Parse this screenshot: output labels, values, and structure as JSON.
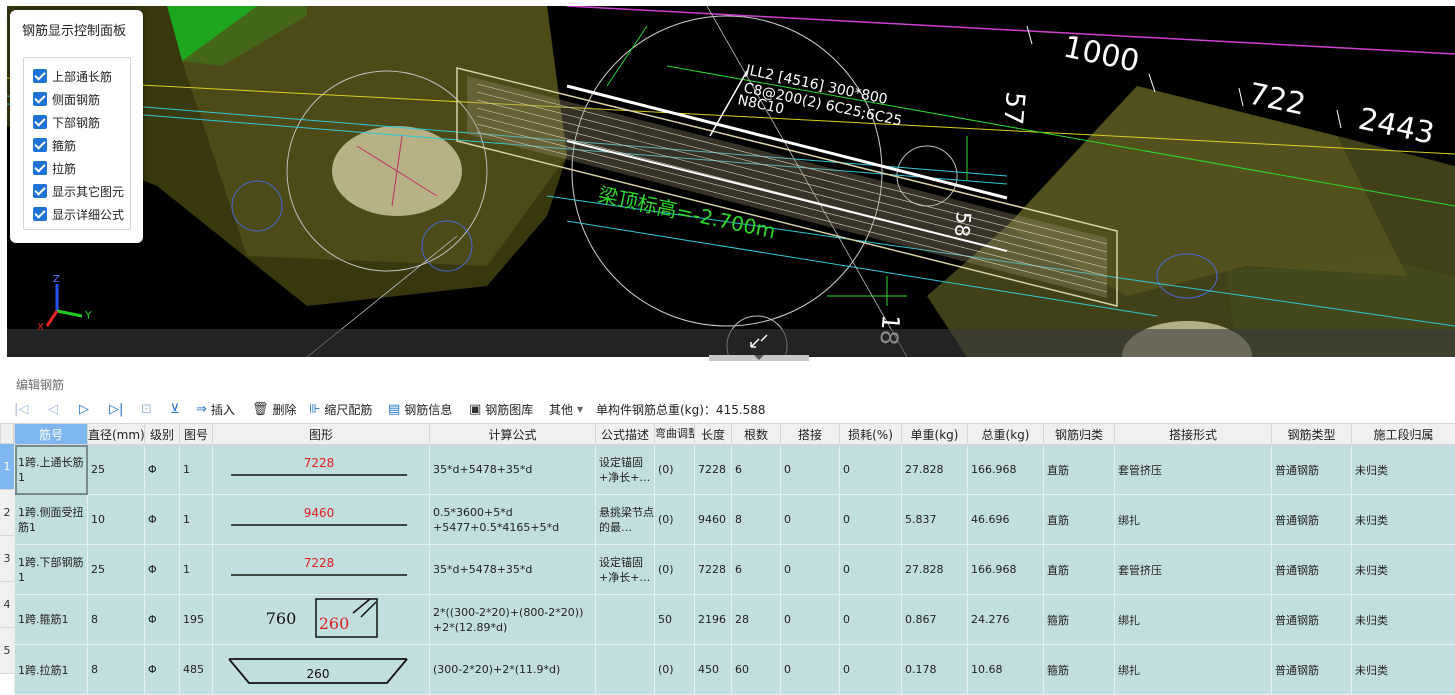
{
  "viewport": {
    "beam_label_line1": "JLL2 [4516] 300*800",
    "beam_label_line2": "C8@200(2) 6C25;6C25",
    "beam_label_line3": "N8C10",
    "elevation_text": "梁顶标高=-2.700m",
    "dim_1000": "1000",
    "dim_722": "722",
    "dim_2443": "2443",
    "dim_57": "57",
    "dim_18": "18",
    "dim_58": "58",
    "axis_z": "Z",
    "axis_y": "Y",
    "axis_x": "X"
  },
  "control_panel": {
    "title": "钢筋显示控制面板",
    "items": [
      {
        "label": "上部通长筋",
        "checked": true
      },
      {
        "label": "侧面钢筋",
        "checked": true
      },
      {
        "label": "下部钢筋",
        "checked": true
      },
      {
        "label": "箍筋",
        "checked": true
      },
      {
        "label": "拉筋",
        "checked": true
      },
      {
        "label": "显示其它图元",
        "checked": true
      },
      {
        "label": "显示详细公式",
        "checked": true
      }
    ]
  },
  "editor": {
    "title": "编辑钢筋",
    "toolbar": {
      "insert": "插入",
      "delete": "删除",
      "scale_rebar": "缩尺配筋",
      "rebar_info": "钢筋信息",
      "rebar_library": "钢筋图库",
      "other": "其他",
      "total_weight": "单构件钢筋总重(kg)：415.588"
    },
    "columns": [
      "筋号",
      "直径(mm)",
      "级别",
      "图号",
      "图形",
      "计算公式",
      "公式描述",
      "弯曲调整",
      "长度",
      "根数",
      "搭接",
      "损耗(%)",
      "单重(kg)",
      "总重(kg)",
      "钢筋归类",
      "搭接形式",
      "钢筋类型",
      "施工段归属"
    ],
    "rows": [
      {
        "num": "1",
        "name": "1跨.上通长筋1",
        "dia": "25",
        "grade": "Φ",
        "fig": "1",
        "shape_val": "7228",
        "formula": "35*d+5478+35*d",
        "desc": "设定锚固+净长+…",
        "bend": "(0)",
        "length": "7228",
        "count": "6",
        "lap": "0",
        "loss": "0",
        "unit_w": "27.828",
        "total_w": "166.968",
        "category": "直筋",
        "lap_type": "套管挤压",
        "rebar_type": "普通钢筋",
        "section": "未归类"
      },
      {
        "num": "2",
        "name": "1跨.侧面受扭筋1",
        "dia": "10",
        "grade": "Φ",
        "fig": "1",
        "shape_val": "9460",
        "formula": "0.5*3600+5*d +5477+0.5*4165+5*d",
        "desc": "悬挑梁节点的最…",
        "bend": "(0)",
        "length": "9460",
        "count": "8",
        "lap": "0",
        "loss": "0",
        "unit_w": "5.837",
        "total_w": "46.696",
        "category": "直筋",
        "lap_type": "绑扎",
        "rebar_type": "普通钢筋",
        "section": "未归类"
      },
      {
        "num": "3",
        "name": "1跨.下部钢筋1",
        "dia": "25",
        "grade": "Φ",
        "fig": "1",
        "shape_val": "7228",
        "formula": "35*d+5478+35*d",
        "desc": "设定锚固+净长+…",
        "bend": "(0)",
        "length": "7228",
        "count": "6",
        "lap": "0",
        "loss": "0",
        "unit_w": "27.828",
        "total_w": "166.968",
        "category": "直筋",
        "lap_type": "套管挤压",
        "rebar_type": "普通钢筋",
        "section": "未归类"
      },
      {
        "num": "4",
        "name": "1跨.箍筋1",
        "dia": "8",
        "grade": "Φ",
        "fig": "195",
        "shape_a": "760",
        "shape_b": "260",
        "formula": "2*((300-2*20)+(800-2*20)) +2*(12.89*d)",
        "desc": "",
        "bend": "50",
        "length": "2196",
        "count": "28",
        "lap": "0",
        "loss": "0",
        "unit_w": "0.867",
        "total_w": "24.276",
        "category": "箍筋",
        "lap_type": "绑扎",
        "rebar_type": "普通钢筋",
        "section": "未归类"
      },
      {
        "num": "5",
        "name": "1跨.拉筋1",
        "dia": "8",
        "grade": "Φ",
        "fig": "485",
        "shape_val": "260",
        "formula": "(300-2*20)+2*(11.9*d)",
        "desc": "",
        "bend": "(0)",
        "length": "450",
        "count": "60",
        "lap": "0",
        "loss": "0",
        "unit_w": "0.178",
        "total_w": "10.68",
        "category": "箍筋",
        "lap_type": "绑扎",
        "rebar_type": "普通钢筋",
        "section": "未归类"
      }
    ]
  },
  "colors": {
    "row_bg": "#c3dedf",
    "selected_header": "#7eb6f0",
    "accent": "#1e73d4"
  }
}
